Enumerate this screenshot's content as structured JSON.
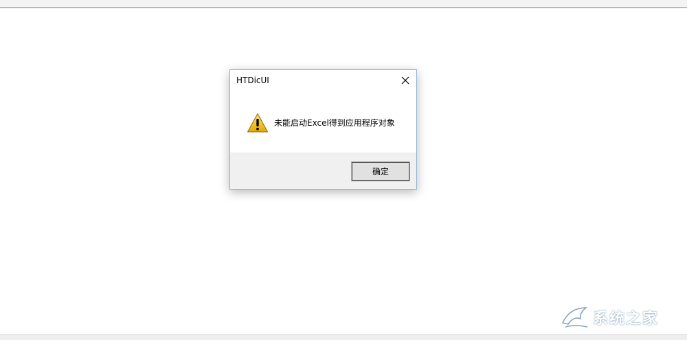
{
  "dialog": {
    "title": "HTDicUI",
    "message": "未能启动Excel得到应用程序对象",
    "ok_label": "确定",
    "close_icon": "close-icon",
    "warning_icon": "warning-icon"
  },
  "watermark": {
    "text": "系统之家"
  },
  "colors": {
    "dialog_border": "#8ab0d6",
    "footer_bg": "#f0f0f0",
    "button_bg": "#e1e1e1",
    "warning_yellow": "#f5c518"
  }
}
